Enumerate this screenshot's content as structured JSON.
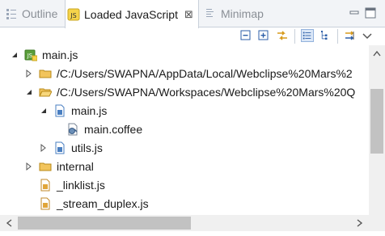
{
  "tabs": [
    {
      "label": "Outline"
    },
    {
      "label": "Loaded JavaScript",
      "close": "⊠"
    },
    {
      "label": "Minimap"
    }
  ],
  "tree": {
    "root": "main.js",
    "folder1": "/C:/Users/SWAPNA/AppData/Local/Webclipse%20Mars%2",
    "folder2": "/C:/Users/SWAPNA/Workspaces/Webclipse%20Mars%20Q",
    "main_js": "main.js",
    "main_coffee": "main.coffee",
    "utils_js": "utils.js",
    "internal": "internal",
    "linklist": "_linklist.js",
    "stream_duplex": "_stream_duplex.js"
  },
  "colors": {
    "accent": "#3b7ad9",
    "folder": "#f2c45c",
    "js_file": "#4a7fc1"
  }
}
